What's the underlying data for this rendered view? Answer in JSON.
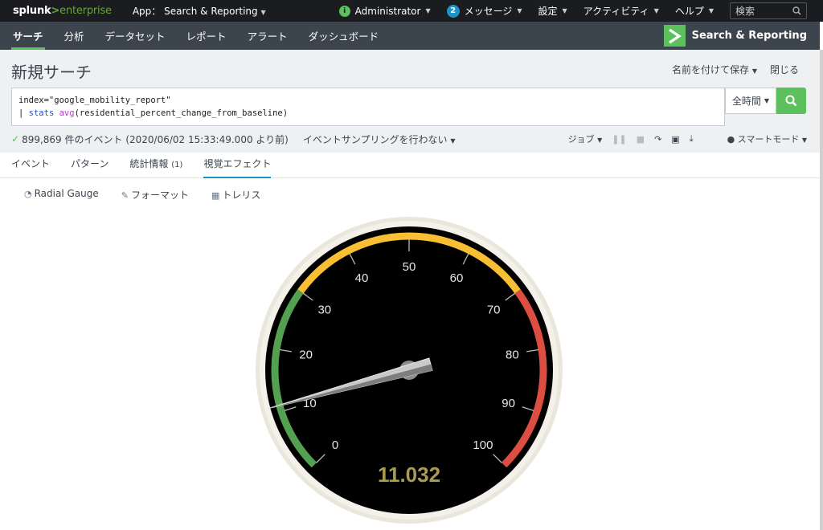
{
  "topbar": {
    "logo_a": "splunk",
    "logo_gt": ">",
    "logo_b": "enterprise",
    "app_label": "App： Search & Reporting",
    "admin_badge": "i",
    "admin": "Administrator",
    "messages_count": "2",
    "messages": "メッセージ",
    "settings": "設定",
    "activity": "アクティビティ",
    "help": "ヘルプ",
    "search_placeholder": "検索"
  },
  "appbar": {
    "nav": [
      "サーチ",
      "分析",
      "データセット",
      "レポート",
      "アラート",
      "ダッシュボード"
    ],
    "app_title": "Search & Reporting"
  },
  "header": {
    "title": "新規サーチ",
    "save_as": "名前を付けて保存",
    "close": "閉じる"
  },
  "query": {
    "line1": "index=\"google_mobility_report\"",
    "line2_pipe": "| ",
    "line2_cmd": "stats",
    "line2_sp": " ",
    "line2_fn": "avg",
    "line2_rest": "(residential_percent_change_from_baseline)",
    "time_range": "全時間"
  },
  "status": {
    "events": "899,869 件のイベント (2020/06/02 15:33:49.000 より前)",
    "sampling": "イベントサンプリングを行わない",
    "job": "ジョブ",
    "mode": "スマートモード"
  },
  "tabs": {
    "events": "イベント",
    "patterns": "パターン",
    "stats": "統計情報",
    "stats_count": "(1)",
    "viz": "視覚エフェクト"
  },
  "viz_toolbar": {
    "type": "Radial Gauge",
    "format": "フォーマット",
    "trellis": "トレリス"
  },
  "gauge": {
    "value": 11.032,
    "value_text": "11.032",
    "min": 0,
    "max": 100,
    "ticks": [
      "0",
      "10",
      "20",
      "30",
      "40",
      "50",
      "60",
      "70",
      "80",
      "90",
      "100"
    ],
    "ranges": [
      {
        "from": 0,
        "to": 30,
        "color": "#53a051"
      },
      {
        "from": 30,
        "to": 70,
        "color": "#f8be34"
      },
      {
        "from": 70,
        "to": 100,
        "color": "#dc4e41"
      }
    ],
    "value_color": "#a99b4f"
  },
  "colors": {
    "topbar": "#1a1c20",
    "appbar": "#3c444d",
    "accent": "#5cc05c",
    "tab_underline": "#1e93c6"
  }
}
